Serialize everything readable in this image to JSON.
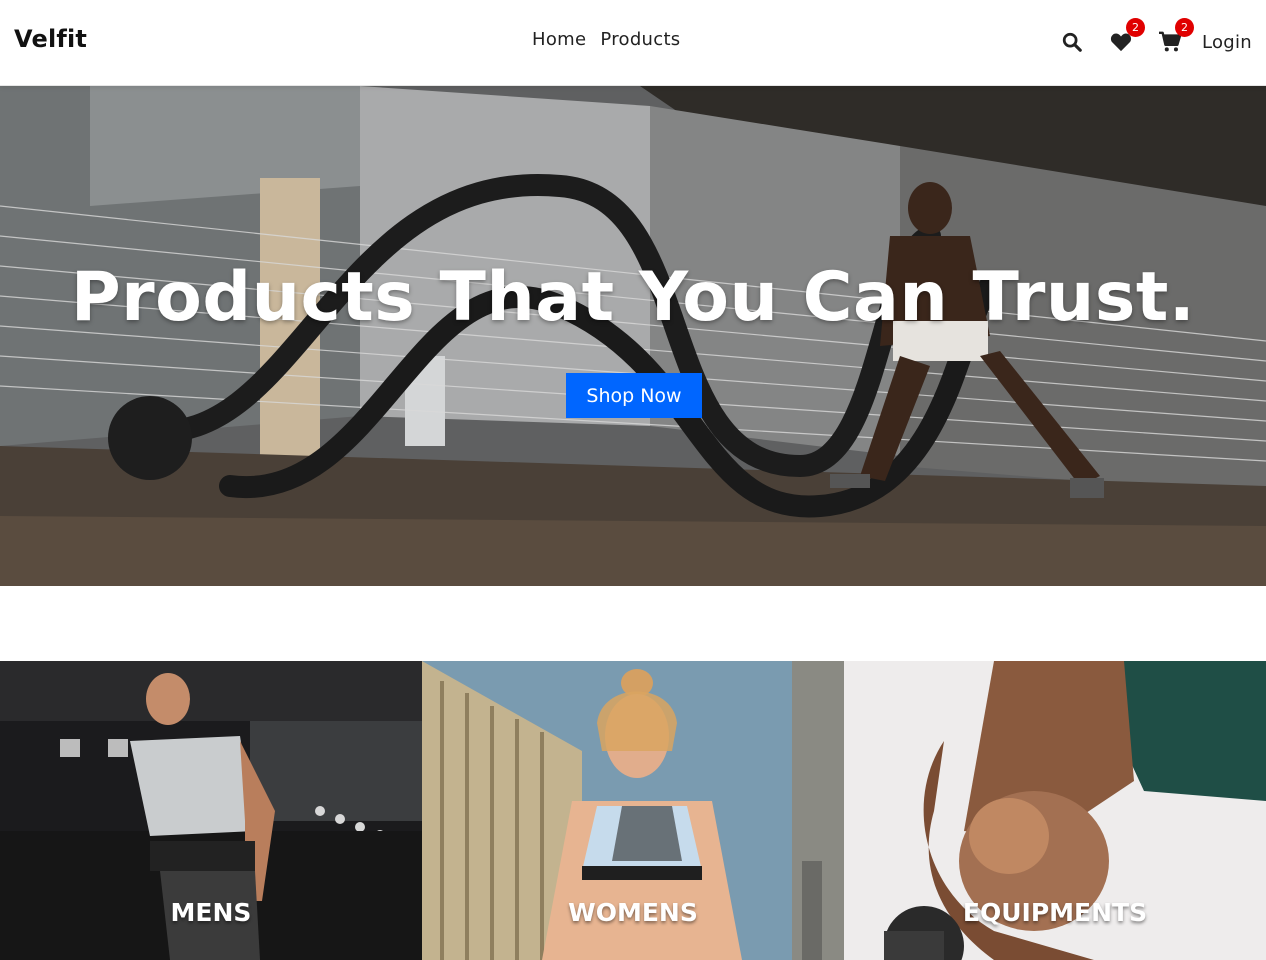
{
  "header": {
    "brand": "Velfit",
    "nav": [
      {
        "label": "Home"
      },
      {
        "label": "Products"
      }
    ],
    "icons": {
      "search": "search-icon",
      "wishlist": "heart-icon",
      "cart": "cart-icon"
    },
    "wishlist_count": "2",
    "cart_count": "2",
    "login_label": "Login"
  },
  "hero": {
    "title": "Products That You Can Trust.",
    "button_label": "Shop Now"
  },
  "categories": [
    {
      "label": "MENS"
    },
    {
      "label": "WOMENS"
    },
    {
      "label": "EQUIPMENTS"
    }
  ],
  "colors": {
    "primary_button": "#0066ff",
    "badge": "#e00000",
    "text": "#222222"
  }
}
